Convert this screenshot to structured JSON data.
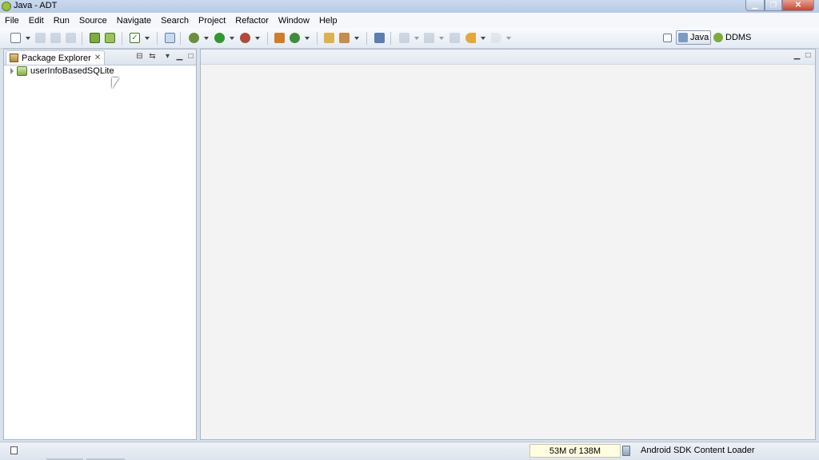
{
  "window": {
    "title": "Java - ADT"
  },
  "menu": [
    "File",
    "Edit",
    "Run",
    "Source",
    "Navigate",
    "Search",
    "Project",
    "Refactor",
    "Window",
    "Help"
  ],
  "perspectives": {
    "java": "Java",
    "ddms": "DDMS"
  },
  "package_explorer": {
    "tab_label": "Package Explorer",
    "close_glyph": "✕",
    "projects": [
      {
        "name": "userInfoBasedSQLite"
      }
    ]
  },
  "statusbar": {
    "heap": "53M of 138M",
    "message": "Android SDK Content Loader"
  },
  "colors": {
    "title_bg": "#c9d9ee",
    "editor_bg": "#f3f3f3",
    "heap_bg": "#fffde1"
  }
}
